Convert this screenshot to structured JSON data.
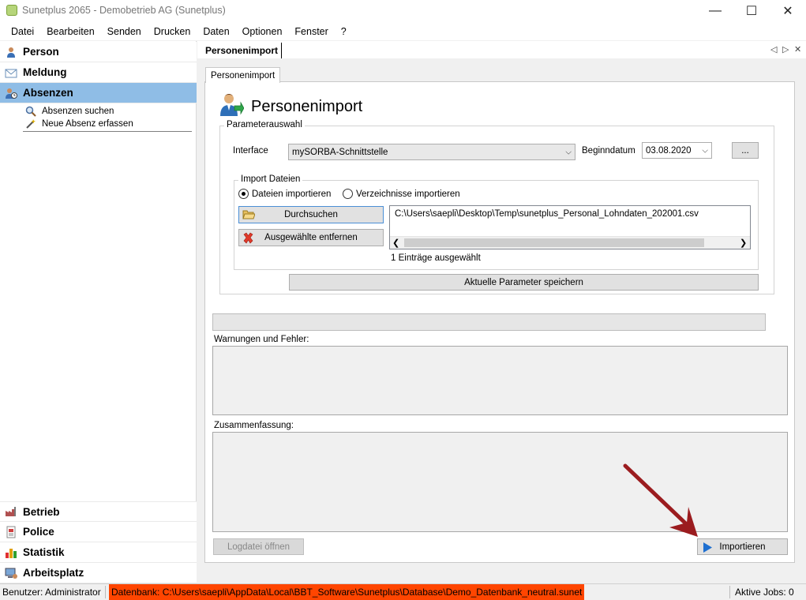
{
  "window": {
    "title": "Sunetplus 2065 - Demobetrieb AG (Sunetplus)",
    "minimize_glyph": "—",
    "maximize_glyph": "☐",
    "close_glyph": "✕"
  },
  "menu": [
    "Datei",
    "Bearbeiten",
    "Senden",
    "Drucken",
    "Daten",
    "Optionen",
    "Fenster",
    "?"
  ],
  "sidebar": {
    "top_items": [
      {
        "label": "Person",
        "icon": "person-icon",
        "active": false
      },
      {
        "label": "Meldung",
        "icon": "mail-icon",
        "active": false
      },
      {
        "label": "Absenzen",
        "icon": "absence-person-icon",
        "active": true
      }
    ],
    "sub_items": [
      {
        "label": "Absenzen suchen",
        "icon": "search-icon"
      },
      {
        "label": "Neue Absenz erfassen",
        "icon": "wand-icon"
      }
    ],
    "bottom_items": [
      {
        "label": "Betrieb",
        "icon": "factory-icon"
      },
      {
        "label": "Police",
        "icon": "document-icon"
      },
      {
        "label": "Statistik",
        "icon": "bar-chart-icon"
      },
      {
        "label": "Arbeitsplatz",
        "icon": "workstation-icon"
      }
    ]
  },
  "doc_tab": {
    "label": "Personenimport"
  },
  "doc_nav": {
    "left": "◁",
    "right": "▷",
    "close": "✕"
  },
  "inner_tab": {
    "label": "Personenimport"
  },
  "page": {
    "title": "Personenimport"
  },
  "params": {
    "group_label": "Parameterauswahl",
    "interface_label": "Interface",
    "interface_value": "mySORBA-Schnittstelle",
    "begin_label": "Beginndatum",
    "begin_value": "03.08.2020",
    "ellipsis_label": "..."
  },
  "import": {
    "group_label": "Import Dateien",
    "radio_files": "Dateien importieren",
    "radio_dirs": "Verzeichnisse importieren",
    "radio_files_checked": true,
    "browse_label": "Durchsuchen",
    "remove_label": "Ausgewählte entfernen",
    "file_path": "C:\\Users\\saepli\\Desktop\\Temp\\sunetplus_Personal_Lohndaten_202001.csv",
    "selected_count": "1 Einträge ausgewählt"
  },
  "save_params_label": "Aktuelle Parameter speichern",
  "warnings_label": "Warnungen und Fehler:",
  "summary_label": "Zusammenfassung:",
  "logfile_label": "Logdatei öffnen",
  "import_label": "Importieren",
  "status": {
    "user": "Benutzer: Administrator",
    "database": "Datenbank: C:\\Users\\saepli\\AppData\\Local\\BBT_Software\\Sunetplus\\Database\\Demo_Datenbank_neutral.sunet",
    "jobs": "Aktive Jobs: 0"
  },
  "colors": {
    "sidebar_active": "#8fbde6",
    "database_highlight": "#ff4500",
    "arrow_annotation": "#9b1c1f"
  }
}
